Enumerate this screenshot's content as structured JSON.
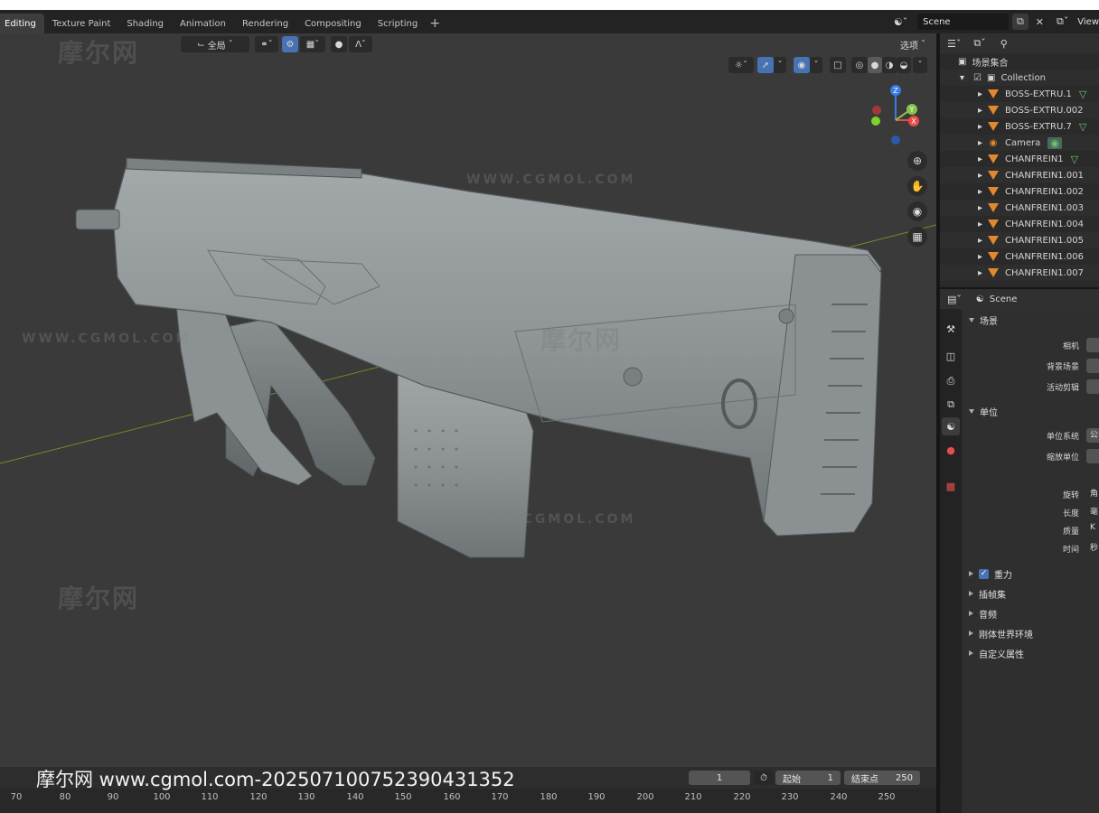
{
  "workspace_tabs": [
    {
      "label": "Editing",
      "active": true
    },
    {
      "label": "Texture Paint",
      "active": false
    },
    {
      "label": "Shading",
      "active": false
    },
    {
      "label": "Animation",
      "active": false
    },
    {
      "label": "Rendering",
      "active": false
    },
    {
      "label": "Compositing",
      "active": false
    },
    {
      "label": "Scripting",
      "active": false
    }
  ],
  "add_tab": "+",
  "scene_selector": {
    "value": "Scene",
    "view_layer": "View"
  },
  "viewport_header": {
    "orientation": "全局",
    "options_label": "选项"
  },
  "outliner": {
    "root": "场景集合",
    "collection": "Collection",
    "items": [
      {
        "name": "BOSS-EXTRU.1",
        "type": "mesh"
      },
      {
        "name": "BOSS-EXTRU.002",
        "type": "mesh"
      },
      {
        "name": "BOSS-EXTRU.7",
        "type": "mesh"
      },
      {
        "name": "Camera",
        "type": "camera"
      },
      {
        "name": "CHANFREIN1",
        "type": "mesh"
      },
      {
        "name": "CHANFREIN1.001",
        "type": "mesh"
      },
      {
        "name": "CHANFREIN1.002",
        "type": "mesh"
      },
      {
        "name": "CHANFREIN1.003",
        "type": "mesh"
      },
      {
        "name": "CHANFREIN1.004",
        "type": "mesh"
      },
      {
        "name": "CHANFREIN1.005",
        "type": "mesh"
      },
      {
        "name": "CHANFREIN1.006",
        "type": "mesh"
      },
      {
        "name": "CHANFREIN1.007",
        "type": "mesh"
      }
    ]
  },
  "properties": {
    "context": "Scene",
    "scene_panel": {
      "title": "场景",
      "fields": [
        "相机",
        "背景场景",
        "活动剪辑"
      ]
    },
    "units_panel": {
      "title": "单位",
      "fields": [
        "单位系统",
        "缩放单位",
        "旋转",
        "长度",
        "质量",
        "时间"
      ],
      "field_value_glyphs": [
        "公",
        "",
        "角",
        "毫",
        "K",
        "秒"
      ]
    },
    "collapsed_panels": [
      {
        "title": "重力",
        "checkbox": true
      },
      {
        "title": "插帧集",
        "checkbox": false
      },
      {
        "title": "音频",
        "checkbox": false
      },
      {
        "title": "刚体世界环境",
        "checkbox": false
      },
      {
        "title": "自定义属性",
        "checkbox": false
      }
    ]
  },
  "timeline": {
    "current_frame": "1",
    "start_label": "起始",
    "start_value": "1",
    "end_label": "结束点",
    "end_value": "250",
    "ruler": [
      "70",
      "80",
      "90",
      "100",
      "110",
      "120",
      "130",
      "140",
      "150",
      "160",
      "170",
      "180",
      "190",
      "200",
      "210",
      "220",
      "230",
      "240",
      "250"
    ]
  },
  "watermarks": {
    "logo": "摩尔网",
    "url": "WWW.CGMOL.COM",
    "caption": "摩尔网 www.cgmol.com-202507100752390431352"
  },
  "colors": {
    "accent": "#4772b3",
    "mesh_icon": "#e2882e",
    "axis_x": "#e84a4a",
    "axis_y": "#8bc34a",
    "axis_z": "#3b7be8"
  },
  "icons": {
    "gizmo": "navigation-gizmo",
    "zoom": "magnifier-icon",
    "pan": "hand-icon",
    "camera_view": "camera-icon",
    "ortho": "grid-icon"
  }
}
